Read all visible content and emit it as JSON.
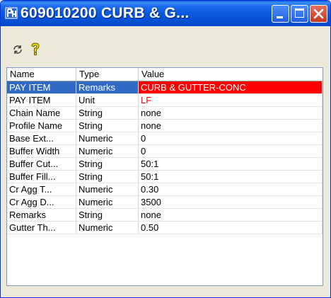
{
  "window": {
    "title": "609010200 CURB & G...",
    "icon": "app-icon"
  },
  "toolbar": {
    "buttons": [
      {
        "name": "refresh-icon"
      },
      {
        "name": "help-icon"
      }
    ]
  },
  "grid": {
    "columns": [
      "Name",
      "Type",
      "Value"
    ],
    "rows": [
      {
        "name": "PAY ITEM",
        "type": "Remarks",
        "value": "CURB & GUTTER-CONC"
      },
      {
        "name": "PAY ITEM",
        "type": "Unit",
        "value": "LF"
      },
      {
        "name": "Chain Name",
        "type": "String",
        "value": "none"
      },
      {
        "name": "Profile Name",
        "type": "String",
        "value": "none"
      },
      {
        "name": "Base Ext...",
        "type": "Numeric",
        "value": "0"
      },
      {
        "name": "Buffer Width",
        "type": "Numeric",
        "value": "0"
      },
      {
        "name": "Buffer Cut...",
        "type": "String",
        "value": "50:1"
      },
      {
        "name": "Buffer Fill...",
        "type": "String",
        "value": "50:1"
      },
      {
        "name": "Cr Agg T...",
        "type": "Numeric",
        "value": "0.30"
      },
      {
        "name": "Cr Agg D...",
        "type": "Numeric",
        "value": "3500"
      },
      {
        "name": "Remarks",
        "type": "String",
        "value": "none"
      },
      {
        "name": "Gutter Th...",
        "type": "Numeric",
        "value": "0.50"
      }
    ]
  },
  "colors": {
    "titlebar": "#0958de",
    "selection": "#316ac5",
    "highlight": "#ff0000"
  }
}
